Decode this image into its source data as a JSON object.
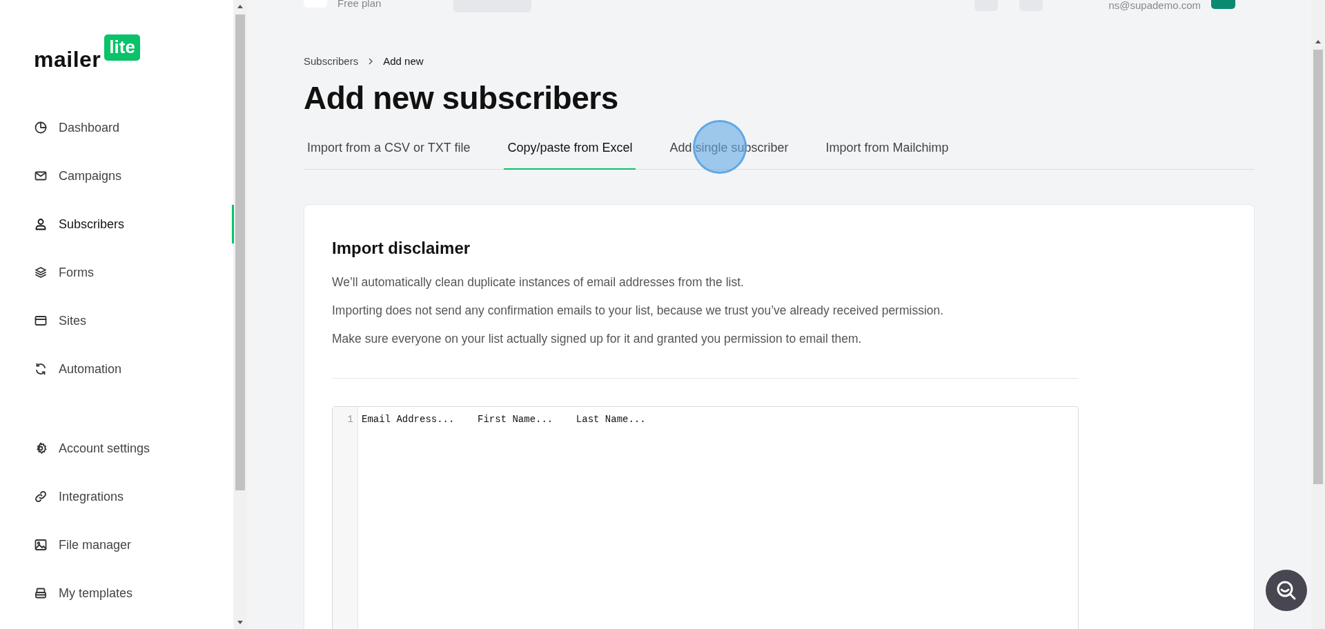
{
  "topbar": {
    "plan": "Free plan",
    "email": "ns@supademo.com"
  },
  "logo": {
    "word": "mailer",
    "badge": "lite"
  },
  "sidebar": {
    "main_items": [
      {
        "label": "Dashboard",
        "selected": false
      },
      {
        "label": "Campaigns",
        "selected": false
      },
      {
        "label": "Subscribers",
        "selected": true
      },
      {
        "label": "Forms",
        "selected": false
      },
      {
        "label": "Sites",
        "selected": false
      },
      {
        "label": "Automation",
        "selected": false
      }
    ],
    "bottom_items": [
      {
        "label": "Account settings",
        "selected": false
      },
      {
        "label": "Integrations",
        "selected": false
      },
      {
        "label": "File manager",
        "selected": false
      },
      {
        "label": "My templates",
        "selected": false
      }
    ]
  },
  "breadcrumb": [
    "Subscribers",
    "Add new"
  ],
  "title": "Add new subscribers",
  "tabs": [
    {
      "label": "Import from a CSV or TXT file",
      "selected": false
    },
    {
      "label": "Copy/paste from Excel",
      "selected": true
    },
    {
      "label": "Add single subscriber",
      "selected": false
    },
    {
      "label": "Import from Mailchimp",
      "selected": false
    }
  ],
  "disclaimer": {
    "title": "Import disclaimer",
    "lines": [
      "We’ll automatically clean duplicate instances of email addresses from the list.",
      "Importing does not send any confirmation emails to your list, because we trust you’ve already received permission.",
      "Make sure everyone on your list actually signed up for it and granted you permission to email them."
    ]
  },
  "editor": {
    "lines": [
      {
        "number": "1",
        "text": "Email Address...    First Name...    Last Name..."
      }
    ]
  }
}
